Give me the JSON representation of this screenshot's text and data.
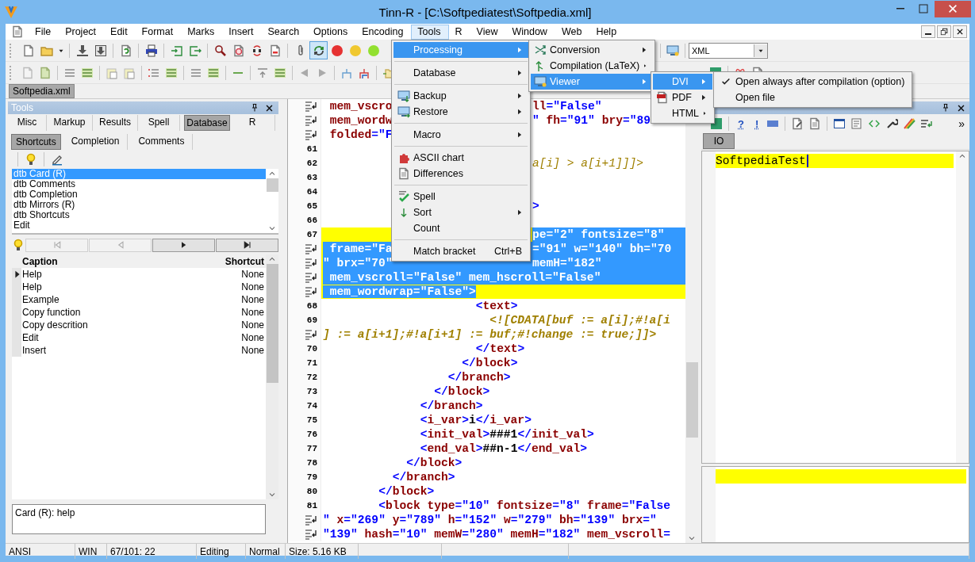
{
  "window": {
    "title": "Tinn-R - [C:\\Softpediatest\\Softpedia.xml]"
  },
  "menu_bar": [
    {
      "label": "File",
      "selected": false
    },
    {
      "label": "Project",
      "selected": false
    },
    {
      "label": "Edit",
      "selected": false
    },
    {
      "label": "Format",
      "selected": false
    },
    {
      "label": "Marks",
      "selected": false
    },
    {
      "label": "Insert",
      "selected": false
    },
    {
      "label": "Search",
      "selected": false
    },
    {
      "label": "Options",
      "selected": false
    },
    {
      "label": "Encoding",
      "selected": false
    },
    {
      "label": "Tools",
      "selected": true
    },
    {
      "label": "R",
      "selected": false
    },
    {
      "label": "View",
      "selected": false
    },
    {
      "label": "Window",
      "selected": false
    },
    {
      "label": "Web",
      "selected": false
    },
    {
      "label": "Help",
      "selected": false
    }
  ],
  "toolbar": {
    "buttons": [
      {
        "pressed": false
      },
      {
        "pressed": false
      },
      {
        "pressed": false
      },
      {
        "pressed": false
      },
      {
        "pressed": false
      },
      {
        "pressed": false
      },
      {
        "pressed": false
      },
      {
        "pressed": false
      },
      {
        "pressed": false
      },
      {
        "pressed": false
      },
      {
        "pressed": false
      },
      {
        "pressed": false
      },
      {
        "pressed": false
      },
      {
        "pressed": false
      },
      {
        "pressed": true
      },
      {
        "pressed": false
      },
      {
        "pressed": false
      },
      {
        "pressed": false
      }
    ],
    "language": "XML"
  },
  "document_tabs": [
    {
      "label": "Softpedia.xml",
      "selected": true
    }
  ],
  "tools_panel": {
    "title": "Tools",
    "tabs": [
      {
        "label": "Misc",
        "selected": false
      },
      {
        "label": "Markup",
        "selected": false
      },
      {
        "label": "Results",
        "selected": false
      },
      {
        "label": "Spell",
        "selected": false
      },
      {
        "label": "Database",
        "selected": true
      },
      {
        "label": "R",
        "selected": false
      }
    ],
    "subtabs": [
      {
        "label": "Shortcuts",
        "selected": true
      },
      {
        "label": "Completion",
        "selected": false
      },
      {
        "label": "Comments",
        "selected": false
      }
    ],
    "list": [
      {
        "label": "dtb Card (R)",
        "selected": true
      },
      {
        "label": "dtb Comments",
        "selected": false
      },
      {
        "label": "dtb Completion",
        "selected": false
      },
      {
        "label": "dtb Mirrors (R)",
        "selected": false
      },
      {
        "label": "dtb Shortcuts",
        "selected": false
      },
      {
        "label": "Edit",
        "selected": false
      }
    ],
    "nav": [
      {
        "disabled": true
      },
      {
        "disabled": true
      },
      {
        "disabled": false
      },
      {
        "disabled": false
      }
    ],
    "grid": {
      "columns": [
        "Caption",
        "Shortcut"
      ],
      "rows": [
        {
          "caption": "Help",
          "shortcut": "None",
          "current": true
        },
        {
          "caption": "Help",
          "shortcut": "None",
          "current": false
        },
        {
          "caption": "Example",
          "shortcut": "None",
          "current": false
        },
        {
          "caption": "Copy function",
          "shortcut": "None",
          "current": false
        },
        {
          "caption": "Copy descrition",
          "shortcut": "None",
          "current": false
        },
        {
          "caption": "Edit",
          "shortcut": "None",
          "current": false
        },
        {
          "caption": "Insert",
          "shortcut": "None",
          "current": false
        }
      ]
    },
    "memo": "Card (R): help"
  },
  "editor": {
    "lines": [
      {
        "kind": "code",
        "text": " mem_vscro",
        "after": "ll=\"False\"",
        "current": false,
        "selected": false,
        "selected_to_end": false
      },
      {
        "kind": "code",
        "text": " mem_wordw",
        "after": "\" fh=\"91\" bry=\"89",
        "current": false,
        "selected": false,
        "selected_to_end": false
      },
      {
        "kind": "code",
        "text": " folded=\"F",
        "current": false,
        "selected": false,
        "selected_to_end": false
      },
      {
        "gutter": "61",
        "current": false,
        "selected": false,
        "selected_to_end": false
      },
      {
        "kind": "cdata",
        "gutter": "62",
        "after": "a[i] > a[i+1]]]>",
        "current": false,
        "selected": false,
        "selected_to_end": false
      },
      {
        "gutter": "63",
        "current": false,
        "selected": false,
        "selected_to_end": false
      },
      {
        "gutter": "64",
        "current": false,
        "selected": false,
        "selected_to_end": false
      },
      {
        "kind": "code",
        "gutter": "65",
        "after": ">",
        "current": false,
        "selected": false,
        "selected_to_end": false
      },
      {
        "gutter": "66",
        "current": false,
        "selected": false,
        "selected_to_end": false
      },
      {
        "kind": "code",
        "gutter": "67",
        "after": "pe=\"2\" fontsize=\"8\"",
        "current": true,
        "selected": true,
        "selected_to_end": true
      },
      {
        "kind": "code",
        "text": " frame=\"Fa",
        "after": "=\"91\" w=\"140\" bh=\"70",
        "current": true,
        "selected": true,
        "selected_to_end": true
      },
      {
        "kind": "code",
        "text": "\" brx=\"70\"",
        "after": "memH=\"182\"",
        "current": true,
        "selected": true,
        "selected_to_end": true
      },
      {
        "kind": "code",
        "text": " mem_vscroll=\"False\" mem_hscroll=\"False\"",
        "current": true,
        "selected": true,
        "selected_to_end": true
      },
      {
        "kind": "code",
        "text": " mem_wordwrap=\"False\">",
        "current": true,
        "selected": true,
        "selected_to_end": false
      },
      {
        "kind": "code",
        "gutter": "68",
        "text": "                      <text>",
        "current": false,
        "selected": false,
        "selected_to_end": false
      },
      {
        "kind": "cdata",
        "gutter": "69",
        "text": "                        <![CDATA[buf := a[i];#!a[i",
        "current": false,
        "selected": false,
        "selected_to_end": false
      },
      {
        "kind": "cdata",
        "text": "] := a[i+1];#!a[i+1] := buf;#!change := true;]]>",
        "current": false,
        "selected": false,
        "selected_to_end": false
      },
      {
        "kind": "code",
        "gutter": "70",
        "text": "                      </text>",
        "current": false,
        "selected": false,
        "selected_to_end": false
      },
      {
        "kind": "code",
        "gutter": "71",
        "text": "                    </block>",
        "current": false,
        "selected": false,
        "selected_to_end": false
      },
      {
        "kind": "code",
        "gutter": "72",
        "text": "                  </branch>",
        "current": false,
        "selected": false,
        "selected_to_end": false
      },
      {
        "kind": "code",
        "gutter": "73",
        "text": "                </block>",
        "current": false,
        "selected": false,
        "selected_to_end": false
      },
      {
        "kind": "code",
        "gutter": "74",
        "text": "              </branch>",
        "current": false,
        "selected": false,
        "selected_to_end": false
      },
      {
        "kind": "code",
        "gutter": "75",
        "text": "              <i_var>i</i_var>",
        "current": false,
        "selected": false,
        "selected_to_end": false
      },
      {
        "kind": "code",
        "gutter": "76",
        "text": "              <init_val>###1</init_val>",
        "current": false,
        "selected": false,
        "selected_to_end": false
      },
      {
        "kind": "code",
        "gutter": "77",
        "text": "              <end_val>##n-1</end_val>",
        "current": false,
        "selected": false,
        "selected_to_end": false
      },
      {
        "kind": "code",
        "gutter": "78",
        "text": "            </block>",
        "current": false,
        "selected": false,
        "selected_to_end": false
      },
      {
        "kind": "code",
        "gutter": "79",
        "text": "          </branch>",
        "current": false,
        "selected": false,
        "selected_to_end": false
      },
      {
        "kind": "code",
        "gutter": "80",
        "text": "        </block>",
        "current": false,
        "selected": false,
        "selected_to_end": false
      },
      {
        "kind": "code",
        "gutter": "81",
        "text": "        <block type=\"10\" fontsize=\"8\" frame=\"False",
        "current": false,
        "selected": false,
        "selected_to_end": false
      },
      {
        "kind": "code",
        "text": "\" x=\"269\" y=\"789\" h=\"152\" w=\"279\" bh=\"139\" brx=\"",
        "current": false,
        "selected": false,
        "selected_to_end": false
      },
      {
        "kind": "code",
        "text": "\"139\" hash=\"10\" memW=\"280\" memH=\"182\" mem_vscroll=",
        "current": false,
        "selected": false,
        "selected_to_end": false
      }
    ]
  },
  "right_panel": {
    "toolbar_glyphs": [
      "?",
      "!"
    ],
    "overflow": "»",
    "tabs": [
      {
        "label": "IO",
        "selected": true
      }
    ],
    "console_text": "SoftpediaTest"
  },
  "status_bar": [
    "ANSI",
    "WIN",
    "67/101: 22",
    "Editing",
    "Normal",
    "Size: 5.16 KB"
  ],
  "menus": {
    "tools": [
      {
        "kind": "item",
        "label": "Processing",
        "submenu": true,
        "selected": true
      },
      {
        "kind": "separator"
      },
      {
        "kind": "item",
        "label": "Database",
        "submenu": true,
        "selected": false
      },
      {
        "kind": "separator"
      },
      {
        "kind": "item",
        "label": "Backup",
        "submenu": true,
        "selected": false
      },
      {
        "kind": "item",
        "label": "Restore",
        "submenu": true,
        "selected": false
      },
      {
        "kind": "separator"
      },
      {
        "kind": "item",
        "label": "Macro",
        "submenu": true,
        "selected": false
      },
      {
        "kind": "separator"
      },
      {
        "kind": "item",
        "label": "ASCII chart",
        "submenu": false,
        "selected": false
      },
      {
        "kind": "item",
        "label": "Differences",
        "submenu": false,
        "selected": false
      },
      {
        "kind": "separator"
      },
      {
        "kind": "item",
        "label": "Spell",
        "submenu": false,
        "selected": false
      },
      {
        "kind": "item",
        "label": "Sort",
        "submenu": true,
        "selected": false
      },
      {
        "kind": "item",
        "label": "Count",
        "submenu": false,
        "selected": false
      },
      {
        "kind": "separator"
      },
      {
        "kind": "item",
        "label": "Match bracket",
        "shortcut": "Ctrl+B",
        "submenu": false,
        "selected": false
      }
    ],
    "processing": [
      {
        "kind": "item",
        "label": "Conversion",
        "submenu": true,
        "selected": false
      },
      {
        "kind": "item",
        "label": "Compilation (LaTeX)",
        "submenu": true,
        "selected": false
      },
      {
        "kind": "item",
        "label": "Viewer",
        "submenu": true,
        "selected": true
      }
    ],
    "viewer": [
      {
        "kind": "item",
        "label": "DVI",
        "submenu": true,
        "selected": true
      },
      {
        "kind": "item",
        "label": "PDF",
        "submenu": true,
        "selected": false
      },
      {
        "kind": "item",
        "label": "HTML",
        "submenu": true,
        "selected": false
      }
    ],
    "dvi": [
      {
        "kind": "item",
        "label": "Open always after compilation (option)",
        "checked": true,
        "submenu": false,
        "selected": false
      },
      {
        "kind": "item",
        "label": "Open file",
        "checked": false,
        "submenu": false,
        "selected": false
      }
    ]
  }
}
